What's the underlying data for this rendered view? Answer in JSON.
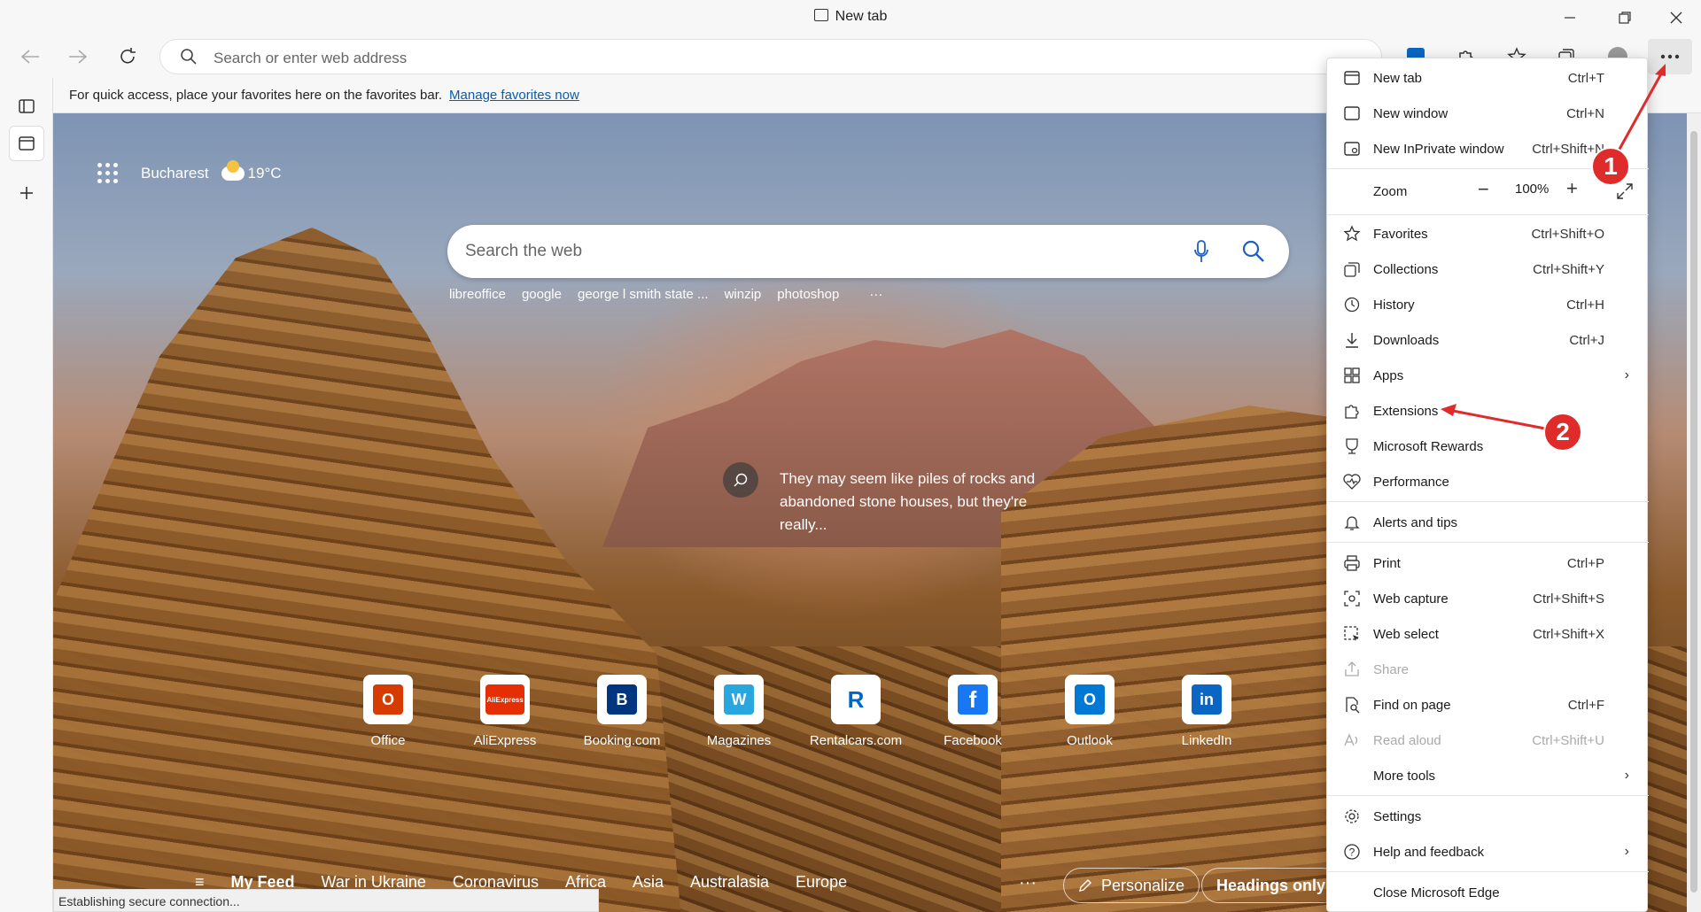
{
  "window": {
    "title": "New tab"
  },
  "toolbar": {
    "address_placeholder": "Search or enter web address"
  },
  "favorites_bar": {
    "text": "For quick access, place your favorites here on the favorites bar.",
    "link": "Manage favorites now"
  },
  "newtab": {
    "weather_city": "Bucharest",
    "weather_temp": "19°C",
    "search_placeholder": "Search the web",
    "recent_searches": [
      "libreoffice",
      "google",
      "george l smith state ...",
      "winzip",
      "photoshop",
      "···"
    ],
    "info_text": "They may seem like piles of rocks and abandoned stone houses, but they're really...",
    "quick_links": [
      {
        "label": "Office",
        "color": "#d83b01",
        "glyph": "O"
      },
      {
        "label": "AliExpress",
        "color": "#e62e04",
        "glyph": "AliExpress"
      },
      {
        "label": "Booking.com",
        "color": "#003580",
        "glyph": "B"
      },
      {
        "label": "Magazines",
        "color": "#2aa6df",
        "glyph": "W"
      },
      {
        "label": "Rentalcars.com",
        "color": "#0066cc",
        "glyph": "R"
      },
      {
        "label": "Facebook",
        "color": "#1877f2",
        "glyph": "f"
      },
      {
        "label": "Outlook",
        "color": "#0078d4",
        "glyph": "O"
      },
      {
        "label": "LinkedIn",
        "color": "#0a66c2",
        "glyph": "in"
      }
    ],
    "feed_tabs": [
      "My Feed",
      "War in Ukraine",
      "Coronavirus",
      "Africa",
      "Asia",
      "Australasia",
      "Europe"
    ],
    "feed_more": "···",
    "personalize": "Personalize",
    "headings_only": "Headings only"
  },
  "status": {
    "text": "Establishing secure connection..."
  },
  "menu": {
    "new_tab": {
      "label": "New tab",
      "shortcut": "Ctrl+T"
    },
    "new_window": {
      "label": "New window",
      "shortcut": "Ctrl+N"
    },
    "new_inprivate": {
      "label": "New InPrivate window",
      "shortcut": "Ctrl+Shift+N"
    },
    "zoom": {
      "label": "Zoom",
      "value": "100%"
    },
    "favorites": {
      "label": "Favorites",
      "shortcut": "Ctrl+Shift+O"
    },
    "collections": {
      "label": "Collections",
      "shortcut": "Ctrl+Shift+Y"
    },
    "history": {
      "label": "History",
      "shortcut": "Ctrl+H"
    },
    "downloads": {
      "label": "Downloads",
      "shortcut": "Ctrl+J"
    },
    "apps": {
      "label": "Apps"
    },
    "extensions": {
      "label": "Extensions"
    },
    "rewards": {
      "label": "Microsoft Rewards"
    },
    "performance": {
      "label": "Performance"
    },
    "alerts": {
      "label": "Alerts and tips"
    },
    "print": {
      "label": "Print",
      "shortcut": "Ctrl+P"
    },
    "web_capture": {
      "label": "Web capture",
      "shortcut": "Ctrl+Shift+S"
    },
    "web_select": {
      "label": "Web select",
      "shortcut": "Ctrl+Shift+X"
    },
    "share": {
      "label": "Share"
    },
    "find": {
      "label": "Find on page",
      "shortcut": "Ctrl+F"
    },
    "read_aloud": {
      "label": "Read aloud",
      "shortcut": "Ctrl+Shift+U"
    },
    "more_tools": {
      "label": "More tools"
    },
    "settings": {
      "label": "Settings"
    },
    "help": {
      "label": "Help and feedback"
    },
    "close": {
      "label": "Close Microsoft Edge"
    }
  },
  "annotations": {
    "badge1": "1",
    "badge2": "2",
    "color": "#e02b2b"
  }
}
